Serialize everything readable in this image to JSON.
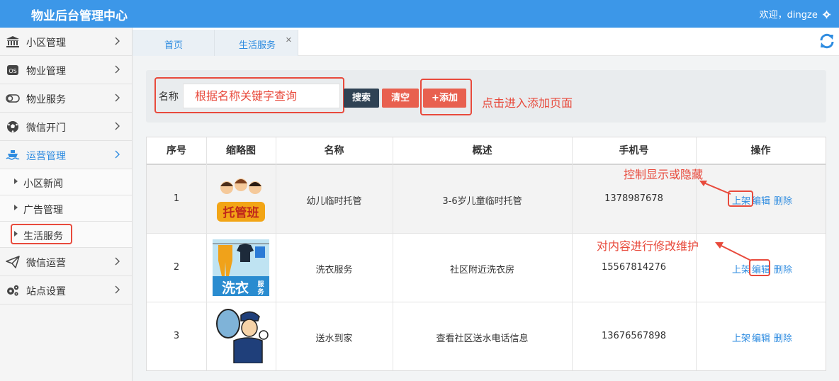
{
  "header": {
    "title": "物业后台管理中心",
    "welcome": "欢迎，dingze",
    "accent": "#3c97e8"
  },
  "sidebar": {
    "items": [
      {
        "label": "小区管理",
        "icon": "bank-icon"
      },
      {
        "label": "物业管理",
        "icon": "os-badge-icon"
      },
      {
        "label": "物业服务",
        "icon": "toggle-icon"
      },
      {
        "label": "微信开门",
        "icon": "soccer-ball-icon"
      },
      {
        "label": "运营管理",
        "icon": "ship-icon",
        "active": true
      },
      {
        "label": "微信运营",
        "icon": "paper-plane-icon"
      },
      {
        "label": "站点设置",
        "icon": "gears-icon"
      }
    ],
    "subitems": [
      "小区新闻",
      "广告管理",
      "生活服务"
    ]
  },
  "tabs": [
    {
      "label": "首页"
    },
    {
      "label": "生活服务",
      "closable": true
    }
  ],
  "search": {
    "label": "名称",
    "placeholder": "根据名称关键字查询",
    "search_button": "搜索",
    "clear_button": "清空",
    "add_button": "+添加"
  },
  "annotations": {
    "add": "点击进入添加页面",
    "toggle": "控制显示或隐藏",
    "edit": "对内容进行修改维护"
  },
  "table": {
    "columns": [
      "序号",
      "缩略图",
      "名称",
      "概述",
      "手机号",
      "操作"
    ],
    "rows": [
      {
        "no": "1",
        "thumb_text": "托管班",
        "name": "幼儿临时托管",
        "summary": "3-6岁儿童临时托管",
        "phone": "1378987678"
      },
      {
        "no": "2",
        "thumb_text": "洗衣服务",
        "name": "洗衣服务",
        "summary": "社区附近洗衣房",
        "phone": "15567814276"
      },
      {
        "no": "3",
        "thumb_text": "",
        "name": "送水到家",
        "summary": "查看社区送水电话信息",
        "phone": "13676567898"
      }
    ],
    "actions": {
      "shelve": "上架",
      "edit": "编辑",
      "delete": "删除"
    }
  },
  "colors": {
    "red": "#e84a3c",
    "dark_button": "#2f4254",
    "link": "#2f8ce0"
  }
}
